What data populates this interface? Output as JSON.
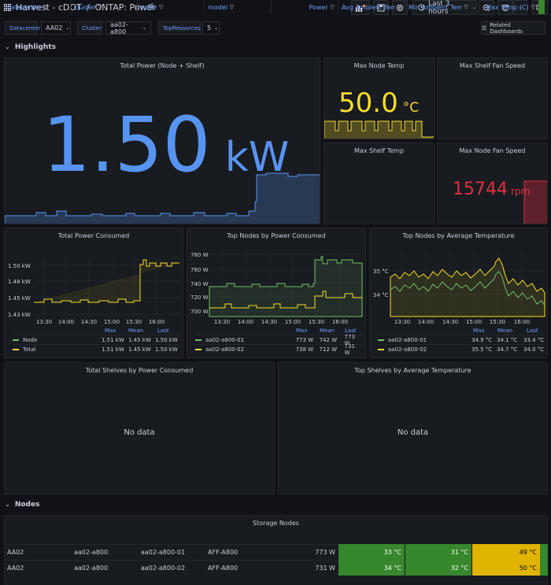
{
  "header": {
    "breadcrumb_root": "Harvest - cDOT",
    "breadcrumb_sep": "/",
    "dashboard_title": "ONTAP: Power",
    "time_range": "Last 3 hours"
  },
  "variables": [
    {
      "label": "Datacenter",
      "value": "AA02"
    },
    {
      "label": "Cluster",
      "value": "aa02-a800"
    },
    {
      "label": "TopResources",
      "value": "5"
    }
  ],
  "related_dashboards": "Related Dashboards",
  "rows": {
    "highlights": "Highlights",
    "nodes": "Nodes"
  },
  "stats": {
    "total_power": {
      "title": "Total Power (Node + Shelf)",
      "value": "1.50",
      "unit": "kW",
      "color": "#5794f2"
    },
    "max_node_temp": {
      "title": "Max Node Temp",
      "value": "50.0",
      "unit": "°C",
      "color": "#fade2a"
    },
    "max_shelf_fan": {
      "title": "Max Shelf Fan Speed"
    },
    "max_shelf_temp": {
      "title": "Max Shelf Temp"
    },
    "max_node_fan": {
      "title": "Max Node Fan Speed",
      "value": "15744",
      "unit": "rpm",
      "color": "#e02f44"
    }
  },
  "timeseries": {
    "legend_headers": {
      "max": "Max",
      "mean": "Mean",
      "last": "Last"
    },
    "total_power": {
      "title": "Total Power Consumed",
      "y_ticks": [
        "1.50 kW",
        "1.48 kW",
        "1.45 kW",
        "1.43 kW"
      ],
      "x_ticks": [
        "13:30",
        "14:00",
        "14:30",
        "15:00",
        "15:30",
        "16:00"
      ],
      "legend": [
        {
          "name": "Node",
          "color": "#73bf69",
          "max": "1.51 kW",
          "mean": "1.45 kW",
          "last": "1.50 kW"
        },
        {
          "name": "Total",
          "color": "#fade2a",
          "max": "1.51 kW",
          "mean": "1.45 kW",
          "last": "1.50 kW"
        }
      ]
    },
    "top_nodes_power": {
      "title": "Top Nodes by Power Consumed",
      "y_ticks": [
        "780 W",
        "760 W",
        "740 W",
        "720 W",
        "700 W"
      ],
      "x_ticks": [
        "13:30",
        "14:00",
        "14:30",
        "15:00",
        "15:30",
        "16:00"
      ],
      "legend": [
        {
          "name": "aa02-a800-01",
          "color": "#73bf69",
          "max": "773 W",
          "mean": "742 W",
          "last": "773 W"
        },
        {
          "name": "aa02-a800-02",
          "color": "#fade2a",
          "max": "738 W",
          "mean": "712 W",
          "last": "731 W"
        }
      ]
    },
    "top_nodes_temp": {
      "title": "Top Nodes by Average Temperature",
      "y_ticks": [
        "35 °C",
        "34 °C"
      ],
      "x_ticks": [
        "13:30",
        "14:00",
        "14:30",
        "15:00",
        "15:30",
        "16:00"
      ],
      "legend": [
        {
          "name": "aa02-a800-01",
          "color": "#73bf69",
          "max": "34.9 °C",
          "mean": "34.1 °C",
          "last": "33.4 °C"
        },
        {
          "name": "aa02-a800-02",
          "color": "#fade2a",
          "max": "35.5 °C",
          "mean": "34.7 °C",
          "last": "34.0 °C"
        }
      ]
    }
  },
  "shelves": {
    "power": {
      "title": "Total Shelves by Power Consumed",
      "empty": "No data"
    },
    "temp": {
      "title": "Top Shelves by Average Temperature",
      "empty": "No data"
    }
  },
  "storage_nodes": {
    "title": "Storage Nodes",
    "columns": [
      "datacenter",
      "cluster",
      "node",
      "model",
      "Power",
      "Avg Ambient Temp",
      "Min Ambient Temp",
      "Max Temp (C)"
    ],
    "rows": [
      {
        "datacenter": "AA02",
        "cluster": "aa02-a800",
        "node": "aa02-a800-01",
        "model": "AFF-A800",
        "power": "773 W",
        "avg": "33 °C",
        "min": "31 °C",
        "max": "49 °C"
      },
      {
        "datacenter": "AA02",
        "cluster": "aa02-a800",
        "node": "aa02-a800-02",
        "model": "AFF-A800",
        "power": "731 W",
        "avg": "34 °C",
        "min": "32 °C",
        "max": "50 °C"
      }
    ],
    "cell_colors": {
      "green": "#37872d",
      "yellow": "#e0b400"
    }
  }
}
